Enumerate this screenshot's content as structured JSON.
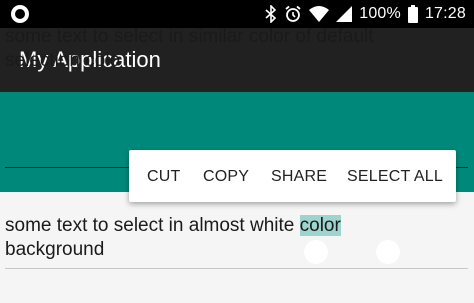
{
  "status_bar": {
    "battery_percent": "100%",
    "time": "17:28",
    "icons": [
      "record-icon",
      "bluetooth-icon",
      "alarm-icon",
      "wifi-icon",
      "signal-icon",
      "battery-icon"
    ]
  },
  "app_bar": {
    "title": "My Application"
  },
  "teal_section": {
    "text_line1": "some text to select in similar color of default",
    "text_line2": "selection colo"
  },
  "white_section": {
    "text_before": "some text to select in almost white ",
    "selected_word": "color",
    "text_after": "background"
  },
  "context_menu": {
    "cut": "CUT",
    "copy": "COPY",
    "share": "SHARE",
    "select_all": "SELECT ALL"
  },
  "colors": {
    "status_bar": "#000000",
    "app_bar": "#212121",
    "teal": "#00897b",
    "selection": "#9fd3cd",
    "background": "#f5f5f5"
  }
}
